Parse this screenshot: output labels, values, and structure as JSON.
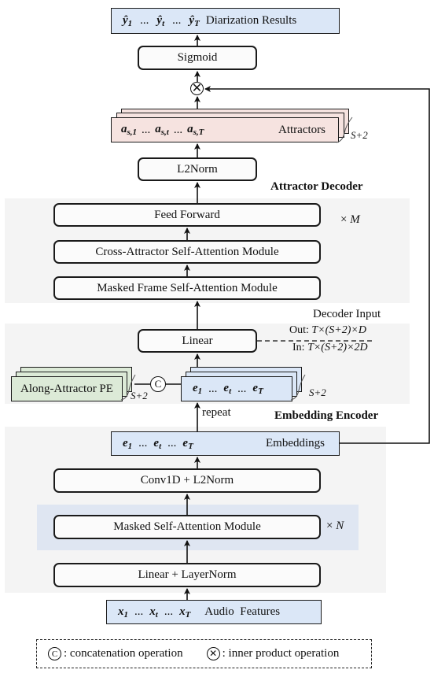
{
  "output": {
    "symbol": "ŷ",
    "subscripts": [
      "1",
      "t",
      "T"
    ],
    "ellipsis": "...",
    "label": "Diarization Results"
  },
  "sigmoid": {
    "label": "Sigmoid"
  },
  "inner_product_symbol": "⊗",
  "attractors": {
    "symbol": "a",
    "subscripts": [
      "s,1",
      "s,t",
      "s,T"
    ],
    "ellipsis": "...",
    "label": "Attractors",
    "stack_count": "S+2"
  },
  "l2norm": {
    "label": "L2Norm"
  },
  "attractor_decoder": {
    "title": "Attractor Decoder",
    "repeat": "× M",
    "repeat_times": "×",
    "repeat_var": "M",
    "blocks": [
      "Feed Forward",
      "Cross-Attractor Self-Attention Module",
      "Masked Frame Self-Attention Module"
    ]
  },
  "decoder_input": {
    "title": "Decoder Input",
    "linear_label": "Linear",
    "out_prefix": "Out: ",
    "out_shape": "T×(S+2)×D",
    "in_prefix": "In: ",
    "in_shape": "T×(S+2)×2D",
    "pe_label": "Along-Attractor PE",
    "pe_stack_count": "S+2",
    "concat_symbol": "C",
    "emb_symbol": "e",
    "emb_subscripts": [
      "1",
      "t",
      "T"
    ],
    "emb_ellipsis": "...",
    "emb_stack_count": "S+2",
    "repeat_label": "repeat"
  },
  "embedding_encoder": {
    "title": "Embedding Encoder",
    "embeddings_symbol": "e",
    "embeddings_subscripts": [
      "1",
      "t",
      "T"
    ],
    "embeddings_ellipsis": "...",
    "embeddings_label": "Embeddings",
    "conv_label": "Conv1D + L2Norm",
    "msa_label": "Masked Self-Attention Module",
    "repeat_times": "×",
    "repeat_var": "N",
    "linear_label": "Linear + LayerNorm"
  },
  "input": {
    "symbol": "x",
    "subscripts": [
      "1",
      "t",
      "T"
    ],
    "ellipsis": "...",
    "label": "Audio  Features"
  },
  "legend": {
    "concat_symbol": "C",
    "concat_text": ": concatenation operation",
    "inner_symbol": "⊗",
    "inner_text": ": inner product operation"
  },
  "colors": {
    "blue_box": "#dbe7f7",
    "pink_box": "#f6e3e0",
    "green_box": "#dcead7",
    "panel_gray": "#f4f4f4",
    "panel_blue": "#dfe6f2"
  }
}
